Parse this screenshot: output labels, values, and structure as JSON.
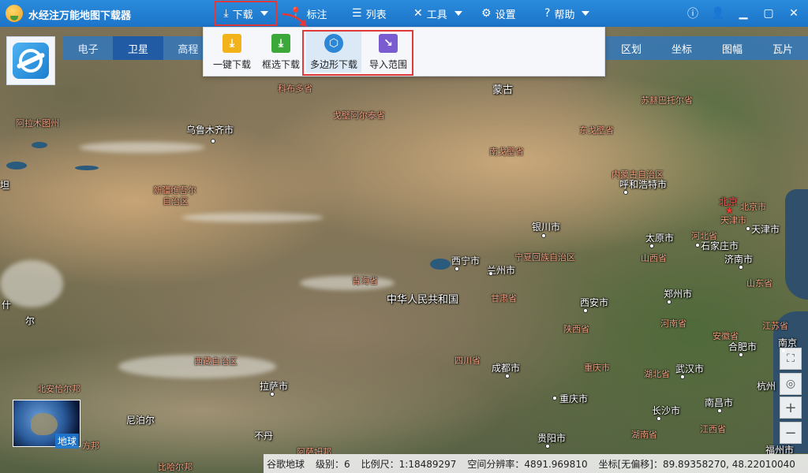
{
  "app": {
    "title": "水经注万能地图下载器"
  },
  "menu": {
    "download": "下载",
    "mark": "标注",
    "list": "列表",
    "tools": "工具",
    "settings": "设置",
    "help": "帮助"
  },
  "download_dropdown": {
    "items": [
      {
        "label": "一键下载",
        "icon": "download-yellow-icon",
        "color": "#f2b31a"
      },
      {
        "label": "框选下载",
        "icon": "box-download-icon",
        "color": "#3ca83a"
      },
      {
        "label": "多边形下载",
        "icon": "polygon-download-icon",
        "color": "#2e86d6"
      },
      {
        "label": "导入范围",
        "icon": "import-range-icon",
        "color": "#7a5bd0"
      }
    ]
  },
  "map_types": {
    "tabs": [
      {
        "label": "电子",
        "active": false
      },
      {
        "label": "卫星",
        "active": true
      },
      {
        "label": "高程",
        "active": false
      }
    ]
  },
  "right_tools": [
    "区划",
    "坐标",
    "图幅",
    "瓦片"
  ],
  "mini_globe": {
    "label": "地球"
  },
  "status": {
    "source": "谷歌地球",
    "level": "级别：6",
    "scale": "比例尺：1:18489297",
    "resolution": "空间分辨率：4891.969810",
    "coords_label": "坐标[无偏移]：",
    "coords_value": "89.89358270,   48.22010040"
  },
  "map_labels": {
    "regions": [
      "科布多省",
      "蒙古",
      "阿拉木图州",
      "戈壁阿尔泰省",
      "苏赫巴托尔省",
      "东戈壁省",
      "南戈壁省",
      "新疆维吾尔",
      "自治区",
      "内蒙古自治区",
      "宁夏回族自治区",
      "青海省",
      "甘肃省",
      "山西省",
      "河北省",
      "天津市",
      "北京市",
      "山东省",
      "陕西省",
      "河南省",
      "江苏省",
      "安徽省",
      "湖北省",
      "四川省",
      "重庆市",
      "西藏自治区",
      "湖南省",
      "江西省",
      "北安恰尔邦",
      "尼泊尔",
      "不丹",
      "阿萨姆邦",
      "比哈尔邦",
      "方邦",
      "坦",
      "什",
      "尔"
    ],
    "cities": [
      "乌鲁木齐市",
      "呼和浩特市",
      "北京",
      "天津市",
      "银川市",
      "太原市",
      "石家庄市",
      "济南市",
      "西宁市",
      "兰州市",
      "中华人民共和国",
      "西安市",
      "郑州市",
      "南京",
      "合肥市",
      "成都市",
      "武汉市",
      "拉萨市",
      "重庆市",
      "杭州",
      "长沙市",
      "南昌市",
      "贵阳市",
      "福州市"
    ]
  }
}
